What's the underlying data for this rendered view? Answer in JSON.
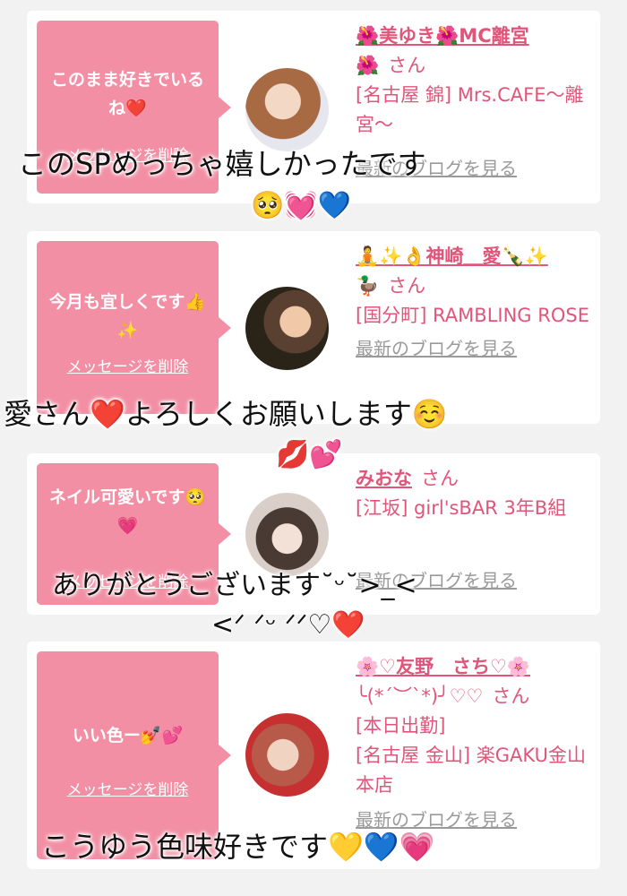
{
  "cards": [
    {
      "message": "このまま好きでいるね❤️",
      "delete_label": "メッセージを削除",
      "user_name": "🌺美ゆき🌺MC離宮",
      "user_name_cont": "🌺",
      "san": "さん",
      "shop": "[名古屋 錦] Mrs.CAFE〜離宮〜",
      "extra": "",
      "blog_label": "最新のブログを見る"
    },
    {
      "message": "今月も宜しくです👍✨",
      "delete_label": "メッセージを削除",
      "user_name": "🧘✨👌神崎＿愛🍾✨",
      "user_name_cont": "🦆",
      "san": "さん",
      "shop": "[国分町] RAMBLING ROSE",
      "extra": "",
      "blog_label": "最新のブログを見る"
    },
    {
      "message": "ネイル可愛いです🥺💗",
      "delete_label": "メッセージを削除",
      "user_name": "みおな",
      "user_name_cont": "",
      "san": "さん",
      "shop": "[江坂] girl'sBAR 3年B組",
      "extra": "",
      "blog_label": "最新のブログを見る"
    },
    {
      "message": "いい色ー💅💕",
      "delete_label": "メッセージを削除",
      "user_name": "🌸♡友野　さち♡🌸",
      "user_name_cont": "╰(*´︶`*)╯♡♡",
      "san": "さん",
      "shop": "[名古屋 金山] 楽GAKU金山本店",
      "extra": "[本日出勤]",
      "blog_label": "最新のブログを見る"
    }
  ],
  "overlays": {
    "o1_line1": "このSPめっちゃ嬉しかったです",
    "o1_line2": "🥺💓💙",
    "o2_line1": "愛さん❤️よろしくお願いします☺️",
    "o2_line2": "💋💕",
    "o3_line1": "ありがとうございます˘ᵕ˘>_<",
    "o3_line2": "<ᐟ ᐟᵕ ᐟᐟ♡❤️",
    "o4_line1": "こうゆう色味好きです💛💙💗"
  },
  "colors": {
    "bubble": "#f28fa4",
    "accent_text": "#e0557a",
    "link_gray": "#9a9a9a",
    "background": "#f2f2f2"
  }
}
